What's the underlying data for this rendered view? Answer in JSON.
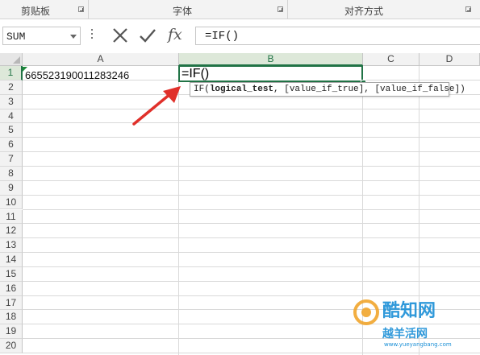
{
  "ribbon": {
    "groups": [
      {
        "label": "剪贴板"
      },
      {
        "label": "字体"
      },
      {
        "label": "对齐方式"
      }
    ]
  },
  "formula_bar": {
    "name_box": "SUM",
    "fx_label": "fx",
    "formula": "=IF()"
  },
  "columns": [
    "A",
    "B",
    "C",
    "D"
  ],
  "rows": [
    "1",
    "2",
    "3",
    "4",
    "5",
    "6",
    "7",
    "8",
    "9",
    "10",
    "11",
    "12",
    "13",
    "14",
    "15",
    "16",
    "17",
    "18",
    "19",
    "20"
  ],
  "cells": {
    "A1": "665523190011283246",
    "B1": "=IF()"
  },
  "tooltip": {
    "fn": "IF(",
    "arg1": "logical_test",
    "rest": ", [value_if_true], [value_if_false])"
  },
  "watermark": {
    "line1": "酷知网",
    "line2": "越羊活网",
    "url": "www.yueyangbang.com"
  },
  "colors": {
    "accent": "#217346",
    "arrow": "#e0302a"
  }
}
